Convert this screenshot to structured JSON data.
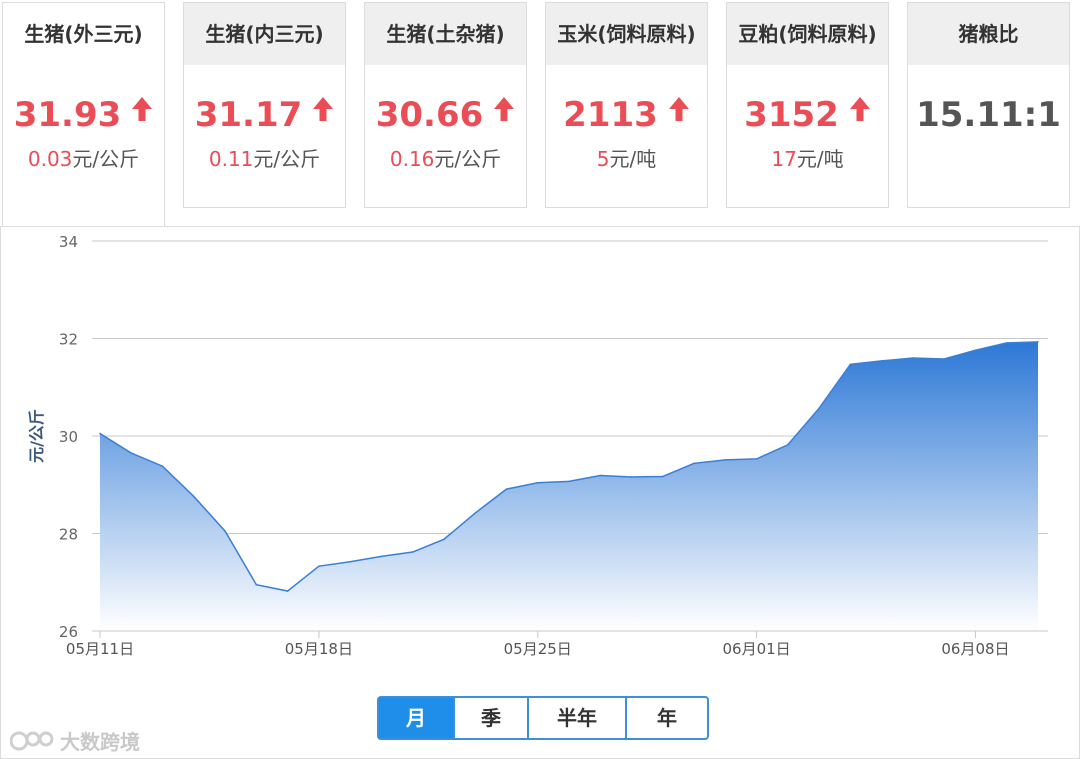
{
  "cards": [
    {
      "title": "生猪(外三元)",
      "price": "31.93",
      "change_num": "0.03",
      "change_unit": "元/公斤",
      "trend": "up"
    },
    {
      "title": "生猪(内三元)",
      "price": "31.17",
      "change_num": "0.11",
      "change_unit": "元/公斤",
      "trend": "up"
    },
    {
      "title": "生猪(土杂猪)",
      "price": "30.66",
      "change_num": "0.16",
      "change_unit": "元/公斤",
      "trend": "up"
    },
    {
      "title": "玉米(饲料原料)",
      "price": "2113",
      "change_num": "5",
      "change_unit": "元/吨",
      "trend": "up"
    },
    {
      "title": "豆粕(饲料原料)",
      "price": "3152",
      "change_num": "17",
      "change_unit": "元/吨",
      "trend": "up"
    },
    {
      "title": "猪粮比",
      "price": "15.11:1"
    }
  ],
  "colors": {
    "accent": "#1e8ee8",
    "up": "#ea4d56",
    "line": "#3a7fd5"
  },
  "range_tabs": [
    {
      "label": "月",
      "active": true
    },
    {
      "label": "季",
      "active": false
    },
    {
      "label": "半年",
      "active": false
    },
    {
      "label": "年",
      "active": false
    }
  ],
  "watermark": "大数跨境",
  "chart_data": {
    "type": "area",
    "ylabel": "元/公斤",
    "ylim": [
      26,
      34
    ],
    "yticks": [
      26,
      28,
      30,
      32,
      34
    ],
    "xticks": [
      "05月11日",
      "05月18日",
      "05月25日",
      "06月01日",
      "06月08日"
    ],
    "x": [
      "05-11",
      "05-12",
      "05-13",
      "05-14",
      "05-15",
      "05-16",
      "05-17",
      "05-18",
      "05-19",
      "05-20",
      "05-21",
      "05-22",
      "05-23",
      "05-24",
      "05-25",
      "05-26",
      "05-27",
      "05-28",
      "05-29",
      "05-30",
      "05-31",
      "06-01",
      "06-02",
      "06-03",
      "06-04",
      "06-05",
      "06-06",
      "06-07",
      "06-08",
      "06-09",
      "06-10"
    ],
    "series": [
      {
        "values": [
          30.05,
          29.65,
          29.38,
          28.76,
          28.05,
          26.95,
          26.82,
          27.33,
          27.42,
          27.53,
          27.62,
          27.88,
          28.42,
          28.91,
          29.04,
          29.07,
          29.19,
          29.16,
          29.17,
          29.44,
          29.51,
          29.53,
          29.82,
          30.57,
          31.47,
          31.54,
          31.6,
          31.58,
          31.76,
          31.91,
          31.93
        ]
      }
    ],
    "grid": true,
    "legend": "none"
  }
}
